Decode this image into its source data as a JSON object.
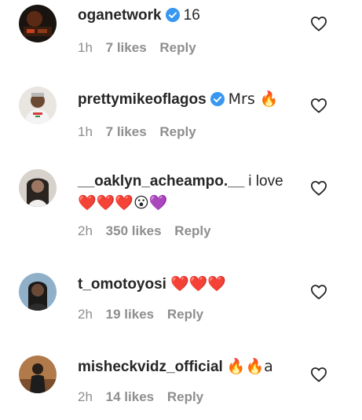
{
  "comments": [
    {
      "username": "oganetwork",
      "verified": true,
      "text": "16",
      "time": "1h",
      "likes": "7 likes",
      "reply": "Reply",
      "avatar_icon": "avatar-dark-icon"
    },
    {
      "username": "prettymikeoflagos",
      "verified": true,
      "text": "Mrs 🔥",
      "time": "1h",
      "likes": "7 likes",
      "reply": "Reply",
      "avatar_icon": "avatar-person-icon"
    },
    {
      "username": "__oaklyn_acheampo.__",
      "verified": false,
      "text": "i love",
      "text2": "❤️❤️❤️😮💜",
      "time": "2h",
      "likes": "350 likes",
      "reply": "Reply",
      "avatar_icon": "avatar-person-icon"
    },
    {
      "username": "t_omotoyosi",
      "verified": false,
      "text": "❤️❤️❤️",
      "time": "2h",
      "likes": "19 likes",
      "reply": "Reply",
      "avatar_icon": "avatar-person-icon"
    },
    {
      "username": "misheckvidz_official",
      "verified": false,
      "text": "🔥🔥a",
      "time": "2h",
      "likes": "14 likes",
      "reply": "Reply",
      "avatar_icon": "avatar-person-icon"
    }
  ],
  "colors": {
    "verified_blue": "#3897f0",
    "text": "#262626",
    "meta_gray": "#8e8e8e"
  }
}
